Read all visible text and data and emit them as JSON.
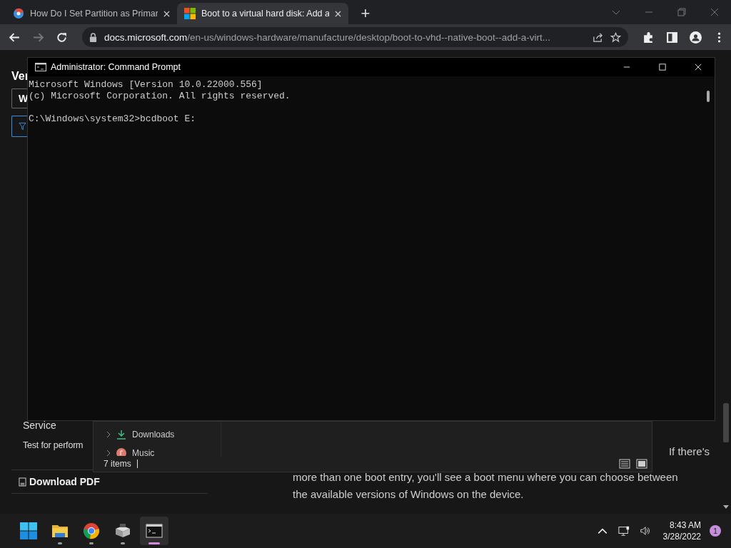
{
  "browser": {
    "tabs": [
      {
        "title": "How Do I Set Partition as Primar",
        "selected": false
      },
      {
        "title": "Boot to a virtual hard disk: Add a",
        "selected": true
      }
    ],
    "new_tab": "+",
    "forward_disabled": true,
    "address": {
      "domain": "docs.microsoft.com",
      "path": "/en-us/windows-hardware/manufacture/desktop/boot-to-vhd--native-boot--add-a-virt..."
    }
  },
  "page": {
    "sidebar": {
      "heading": "Ver",
      "version_button": "W",
      "items": [
        "Service",
        "Test for perform"
      ],
      "download": "Download PDF"
    },
    "article_lines": [
      "If there's",
      "more than one boot entry, you'll see a boot menu where you can choose between",
      "the available versions of Windows on the device."
    ]
  },
  "command_prompt": {
    "title": "Administrator: Command Prompt",
    "blocks": [
      "Microsoft Windows [Version 10.0.22000.556]\n(c) Microsoft Corporation. All rights reserved.",
      "C:\\Windows\\system32>bcdboot E:"
    ]
  },
  "file_explorer": {
    "folders": [
      {
        "name": "Downloads",
        "kind": "download"
      },
      {
        "name": "Music",
        "kind": "music"
      }
    ],
    "status": "7 items"
  },
  "taskbar": {
    "apps": [
      {
        "kind": "start",
        "running": false,
        "selected": false
      },
      {
        "kind": "folder",
        "running": true,
        "selected": false
      },
      {
        "kind": "chrome",
        "running": true,
        "selected": false
      },
      {
        "kind": "installer",
        "running": true,
        "selected": false
      },
      {
        "kind": "terminal",
        "running": true,
        "selected": true
      }
    ],
    "time": "8:43 AM",
    "date": "3/28/2022",
    "notifications": "1"
  }
}
